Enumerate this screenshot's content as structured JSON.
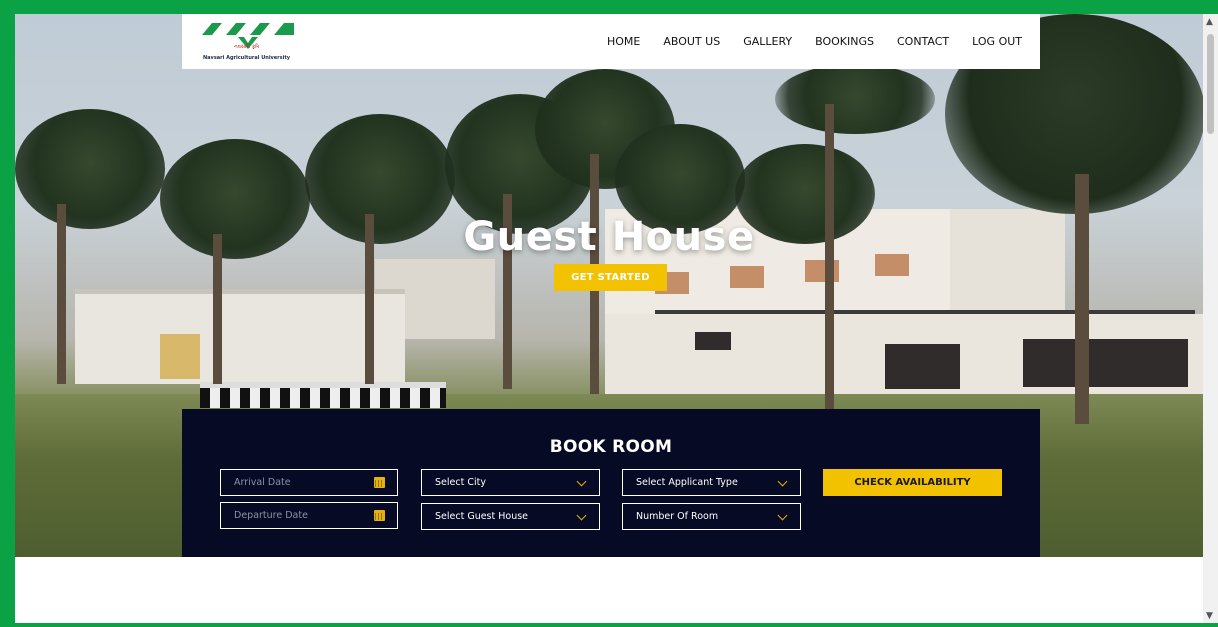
{
  "header": {
    "logo_text": "Navsari Agricultural University",
    "logo_subtext": "નવસારી કૃષિ",
    "nav": [
      "HOME",
      "ABOUT US",
      "GALLERY",
      "BOOKINGS",
      "CONTACT",
      "LOG OUT"
    ]
  },
  "hero": {
    "title": "Guest House",
    "cta_label": "GET STARTED"
  },
  "booking": {
    "title": "BOOK ROOM",
    "arrival_placeholder": "Arrival Date",
    "departure_placeholder": "Departure Date",
    "city_select": "Select City",
    "guest_house_select": "Select Guest House",
    "applicant_type_select": "Select Applicant Type",
    "rooms_select": "Number Of Room",
    "check_button": "CHECK AVAILABILITY"
  },
  "colors": {
    "frame": "#0aa245",
    "accent": "#f2c200",
    "panel": "#060a24",
    "logo_green": "#1a9a4a"
  },
  "icons": [
    "calendar-icon",
    "chevron-down-icon",
    "scroll-up-icon",
    "scroll-down-icon"
  ]
}
